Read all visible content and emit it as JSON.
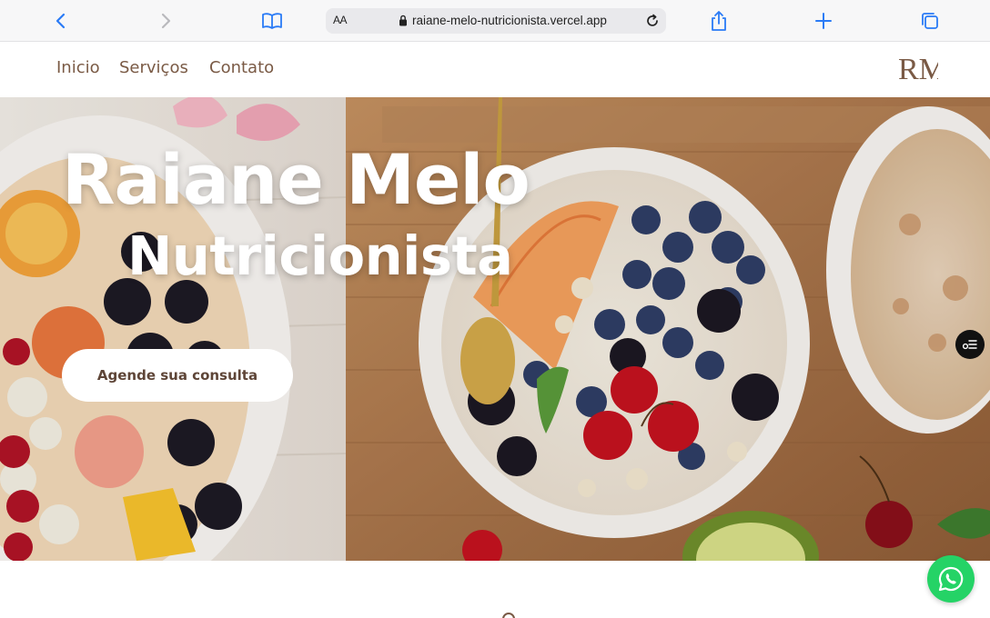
{
  "browser": {
    "aa_label": "AA",
    "url": "raiane-melo-nutricionista.vercel.app",
    "icons": [
      "back-icon",
      "forward-icon",
      "book-icon",
      "lock-icon",
      "reload-icon",
      "share-icon",
      "plus-icon",
      "tabs-icon"
    ]
  },
  "nav": {
    "links": [
      "Inicio",
      "Serviços",
      "Contato"
    ],
    "logo_text": "RM"
  },
  "hero": {
    "title": "Raiane Melo",
    "subtitle": "Nutricionista",
    "cta_label": "Agende sua consulta"
  },
  "colors": {
    "brand_brown": "#7a5a45",
    "cta_text": "#5e4537",
    "whatsapp": "#25d366",
    "safari_blue": "#2a7bf6"
  }
}
